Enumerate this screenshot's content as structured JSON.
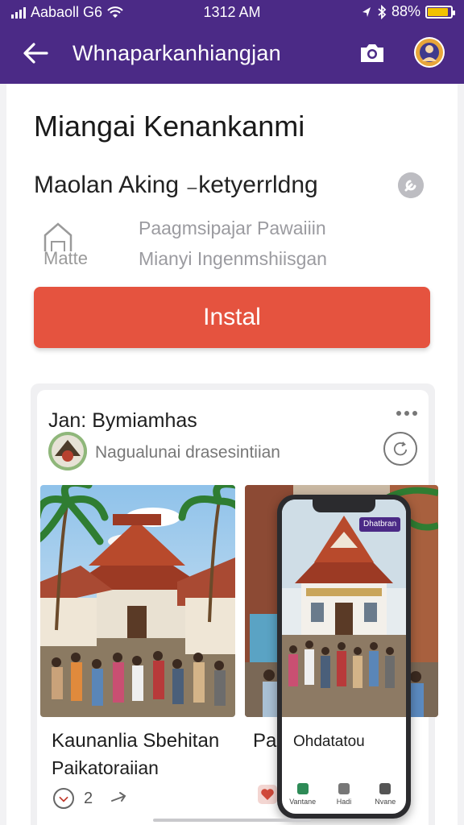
{
  "status_bar": {
    "carrier": "Aabaoll G6",
    "time": "1312 AM",
    "battery": "88%",
    "battery_level": 0.88
  },
  "header": {
    "title": "Whnaparkanhiangjan",
    "accent": "#4b2a86"
  },
  "app": {
    "title": "Miangai Kenankanmi",
    "subtitle": "Maolan  Aking ₋ketyerrldng",
    "logo_text": "Matte",
    "meta_line1": "Paagmsipajar Pawaiiin",
    "meta_line2": "Mianyi Ingenmshiisgan",
    "install_label": "Instal",
    "install_color": "#e5533f"
  },
  "post": {
    "author": "Jan: Bymiamhas",
    "meta": "Nagualunai drasesintiian",
    "caption1_line1": "Kaunanlia Sbehitan",
    "caption1_line2": "Paikatoraiian",
    "caption2": "Par",
    "like_count": "2"
  },
  "phone_mockup": {
    "badge": "Dhatbran",
    "caption": "Ohdatatou",
    "nav": [
      {
        "label": "Vantane",
        "color": "#2e8b57"
      },
      {
        "label": "Hadi",
        "color": "#777777"
      },
      {
        "label": "Nvane",
        "color": "#555555"
      }
    ]
  }
}
